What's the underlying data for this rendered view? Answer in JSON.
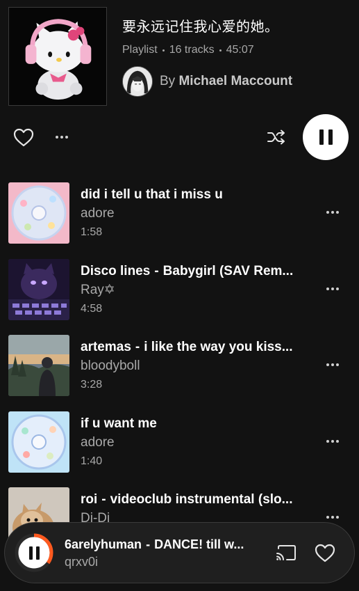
{
  "playlist": {
    "title": "要永远记住我心爱的她。",
    "type": "Playlist",
    "track_count": "16 tracks",
    "duration": "45:07",
    "by_prefix": "By",
    "author": "Michael Maccount"
  },
  "controls": {
    "like_icon": "heart-outline-icon",
    "more_icon": "more-horizontal-icon",
    "shuffle_icon": "shuffle-icon",
    "play_state": "pause-icon"
  },
  "tracks": [
    {
      "title": "did i tell u that i miss u",
      "artist_prefix": "",
      "artist": "adore",
      "duration": "1:58"
    },
    {
      "title": "Babygirl (SAV Rem...",
      "artist_prefix": "Disco lines",
      "artist": "Ray✡",
      "duration": "4:58"
    },
    {
      "title": "i like the way you kiss...",
      "artist_prefix": "artemas",
      "artist": "bloodyboll",
      "duration": "3:28"
    },
    {
      "title": "if u want me",
      "artist_prefix": "",
      "artist": "adore",
      "duration": "1:40"
    },
    {
      "title": "videoclub instrumental (slo...",
      "artist_prefix": "roi",
      "artist": "Di-Di",
      "duration": ""
    }
  ],
  "now_playing": {
    "artist_prefix": "6arelyhuman",
    "title": "DANCE! till w...",
    "subtitle": "qrxv0i",
    "progress": 0.35,
    "progress_color": "#ff5a1f",
    "cast_icon": "cast-icon",
    "like_icon": "heart-outline-icon"
  },
  "colors": {
    "background": "#121212",
    "text_secondary": "#a9a9a9",
    "accent": "#ff5a1f"
  }
}
